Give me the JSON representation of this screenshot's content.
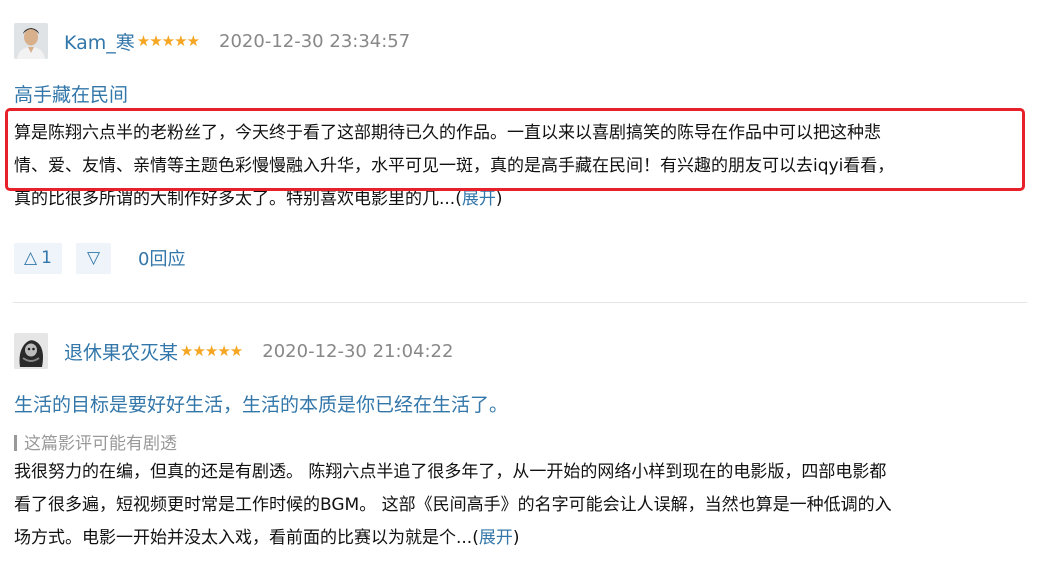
{
  "reviews": [
    {
      "username": "Kam_寒",
      "stars": "★★★★★",
      "rating": 5,
      "time": "2020-12-30 23:34:57",
      "title": "高手藏在民间",
      "lines": [
        "算是陈翔六点半的老粉丝了，今天终于看了这部期待已久的作品。一直以来以喜剧搞笑的陈导在作品中可以把这种悲",
        "情、爱、友情、亲情等主题色彩慢慢融入升华，水平可见一斑，真的是高手藏在民间！有兴趣的朋友可以去iqyi看看，",
        "真的比很多所谓的大制作好多太了。特别喜欢电影里的几..."
      ],
      "expand_label": "展开",
      "useful_count": "1",
      "reply_label": "0回应"
    },
    {
      "username": "退休果农灭某",
      "stars": "★★★★★",
      "rating": 5,
      "time": "2020-12-30 21:04:22",
      "title": "生活的目标是要好好生活，生活的本质是你已经在生活了。",
      "spoiler": "这篇影评可能有剧透",
      "lines": [
        "我很努力的在编，但真的还是有剧透。 陈翔六点半追了很多年了，从一开始的网络小样到现在的电影版，四部电影都",
        "看了很多遍，短视频更时常是工作时候的BGM。 这部《民间高手》的名字可能会让人误解，当然也算是一种低调的入",
        "场方式。电影一开始并没太入戏，看前面的比赛以为就是个..."
      ],
      "expand_label": "展开"
    }
  ],
  "icons": {
    "vote_up": "△",
    "vote_down": "▽"
  },
  "colors": {
    "link": "#3377aa",
    "star": "#f5a623",
    "highlight_border": "#e8202a",
    "vote_bg": "#eef4f9"
  }
}
